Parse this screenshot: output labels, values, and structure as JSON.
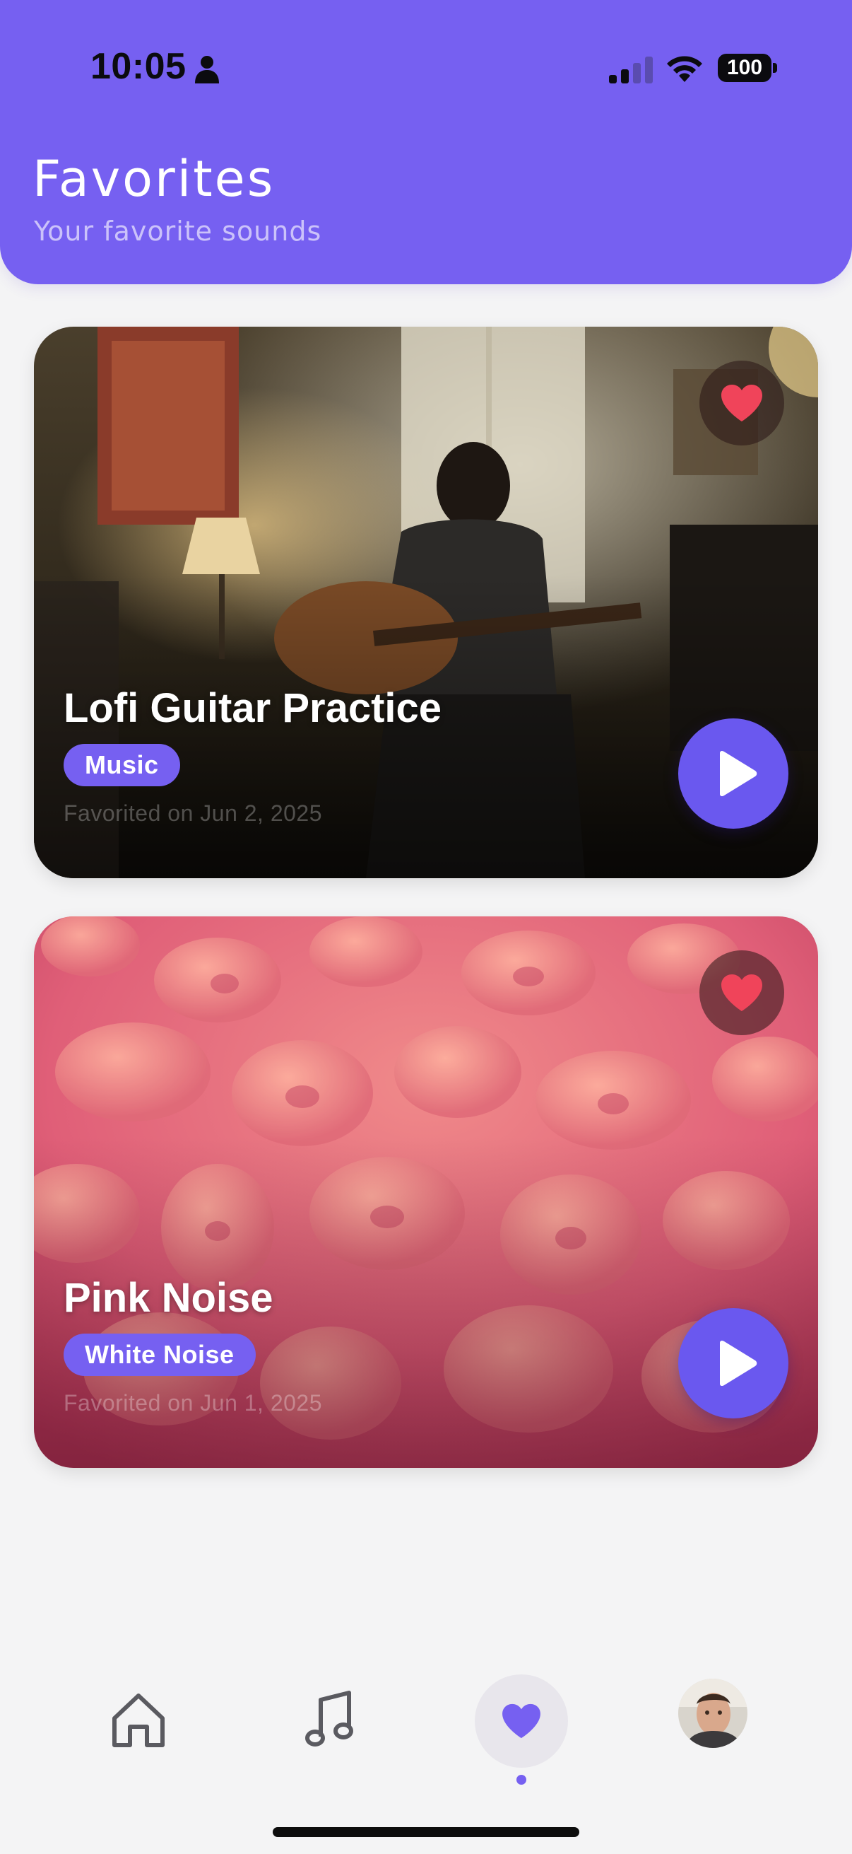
{
  "status_bar": {
    "time": "10:05",
    "battery": "100"
  },
  "header": {
    "title": "Favorites",
    "subtitle": "Your favorite sounds"
  },
  "favorites": [
    {
      "title": "Lofi Guitar Practice",
      "category": "Music",
      "favorited_on": "Favorited on Jun 2, 2025"
    },
    {
      "title": "Pink Noise",
      "category": "White Noise",
      "favorited_on": "Favorited on Jun 1, 2025"
    }
  ],
  "nav": {
    "items": [
      "home-icon",
      "music-note-icon",
      "heart-icon",
      "avatar"
    ],
    "active": "heart-icon"
  },
  "colors": {
    "accent": "#7660f1",
    "heart": "#f0445a",
    "background": "#f4f4f5"
  }
}
